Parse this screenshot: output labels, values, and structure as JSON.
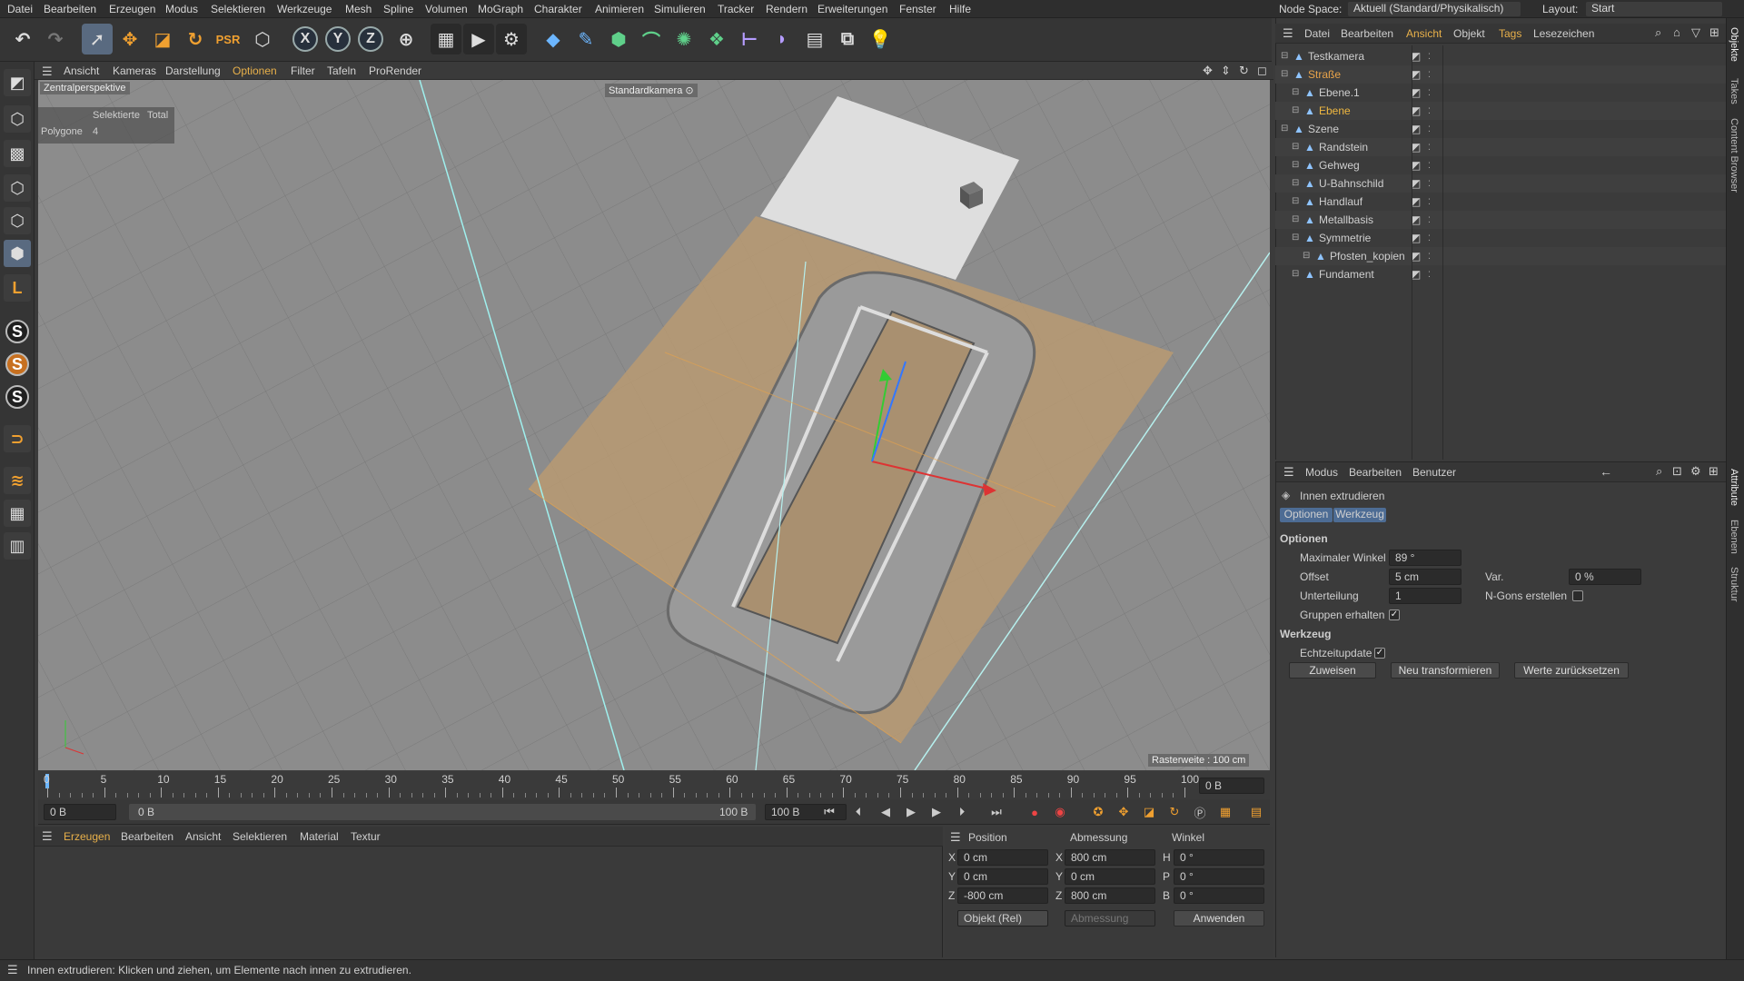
{
  "menubar": {
    "items": [
      "Datei",
      "Bearbeiten",
      "Erzeugen",
      "Modus",
      "Selektieren",
      "Werkzeuge",
      "Mesh",
      "Spline",
      "Volumen",
      "MoGraph",
      "Charakter",
      "Animieren",
      "Simulieren",
      "Tracker",
      "Rendern",
      "Erweiterungen",
      "Fenster",
      "Hilfe"
    ],
    "node_space_label": "Node Space:",
    "node_space_value": "Aktuell (Standard/Physikalisch)",
    "layout_label": "Layout:",
    "layout_value": "Start"
  },
  "toolbar": {
    "axis_x": "X",
    "axis_y": "Y",
    "axis_z": "Z"
  },
  "viewport": {
    "menu": [
      "Ansicht",
      "Kameras",
      "Darstellung",
      "Optionen",
      "Filter",
      "Tafeln",
      "ProRender"
    ],
    "active_menu_color": "#e8b04a",
    "projection": "Zentralperspektive",
    "camera": "Standardkamera",
    "stats_header_sel": "Selektierte",
    "stats_header_total": "Total",
    "stats_label": "Polygone",
    "stats_value": "4",
    "grid_info": "Rasterweite : 100 cm"
  },
  "timeline": {
    "ticks": [
      "0",
      "5",
      "10",
      "15",
      "20",
      "25",
      "30",
      "35",
      "40",
      "45",
      "50",
      "55",
      "60",
      "65",
      "70",
      "75",
      "80",
      "85",
      "90",
      "95",
      "100"
    ],
    "current_frame": "0 B"
  },
  "transport": {
    "start": "0 B",
    "range_start": "0 B",
    "range_end": "100 B",
    "end": "100 B"
  },
  "material_panel": {
    "menu": [
      "Erzeugen",
      "Bearbeiten",
      "Ansicht",
      "Selektieren",
      "Material",
      "Textur"
    ]
  },
  "coords": {
    "col_position": "Position",
    "col_size": "Abmessung",
    "col_angle": "Winkel",
    "rows": [
      {
        "axis": "X",
        "pos": "0 cm",
        "saxis": "X",
        "size": "800 cm",
        "aaxis": "H",
        "angle": "0 °"
      },
      {
        "axis": "Y",
        "pos": "0 cm",
        "saxis": "Y",
        "size": "0 cm",
        "aaxis": "P",
        "angle": "0 °"
      },
      {
        "axis": "Z",
        "pos": "-800 cm",
        "saxis": "Z",
        "size": "800 cm",
        "aaxis": "B",
        "angle": "0 °"
      }
    ],
    "mode": "Objekt (Rel)",
    "size_mode": "Abmessung",
    "apply": "Anwenden"
  },
  "objects": {
    "menu": [
      "Datei",
      "Bearbeiten",
      "Ansicht",
      "Objekt",
      "Tags",
      "Lesezeichen"
    ],
    "items": [
      {
        "name": "Testkamera",
        "indent": 0,
        "color": "#cfcfcf",
        "alt": false
      },
      {
        "name": "Straße",
        "indent": 0,
        "color": "#e8a34a",
        "alt": true
      },
      {
        "name": "Ebene.1",
        "indent": 1,
        "color": "#cfcfcf",
        "alt": false
      },
      {
        "name": "Ebene",
        "indent": 1,
        "color": "#f0b840",
        "alt": true
      },
      {
        "name": "Szene",
        "indent": 0,
        "color": "#cfcfcf",
        "alt": false
      },
      {
        "name": "Randstein",
        "indent": 1,
        "color": "#cfcfcf",
        "alt": true
      },
      {
        "name": "Gehweg",
        "indent": 1,
        "color": "#cfcfcf",
        "alt": false
      },
      {
        "name": "U-Bahnschild",
        "indent": 1,
        "color": "#cfcfcf",
        "alt": true
      },
      {
        "name": "Handlauf",
        "indent": 1,
        "color": "#cfcfcf",
        "alt": false
      },
      {
        "name": "Metallbasis",
        "indent": 1,
        "color": "#cfcfcf",
        "alt": true
      },
      {
        "name": "Symmetrie",
        "indent": 1,
        "color": "#cfcfcf",
        "alt": false
      },
      {
        "name": "Pfosten_kopien",
        "indent": 2,
        "color": "#cfcfcf",
        "alt": true
      },
      {
        "name": "Fundament",
        "indent": 1,
        "color": "#cfcfcf",
        "alt": false
      }
    ]
  },
  "attributes": {
    "menu": [
      "Modus",
      "Bearbeiten",
      "Benutzer"
    ],
    "tool_name": "Innen extrudieren",
    "tabs": [
      "Optionen",
      "Werkzeug"
    ],
    "section_options": "Optionen",
    "max_angle_label": "Maximaler Winkel",
    "max_angle_value": "89 °",
    "offset_label": "Offset",
    "offset_value": "5 cm",
    "var_label": "Var.",
    "var_value": "0 %",
    "subdiv_label": "Unterteilung",
    "subdiv_value": "1",
    "ngons_label": "N-Gons erstellen",
    "groups_label": "Gruppen erhalten",
    "section_tool": "Werkzeug",
    "realtime_label": "Echtzeitupdate",
    "btn_assign": "Zuweisen",
    "btn_retransform": "Neu transformieren",
    "btn_reset": "Werte zurücksetzen"
  },
  "side_tabs": [
    "Objekte",
    "Takes",
    "Content Browser",
    "Attribute",
    "Ebenen",
    "Struktur"
  ],
  "status": {
    "text": "Innen extrudieren: Klicken und ziehen, um Elemente nach innen zu extrudieren."
  }
}
